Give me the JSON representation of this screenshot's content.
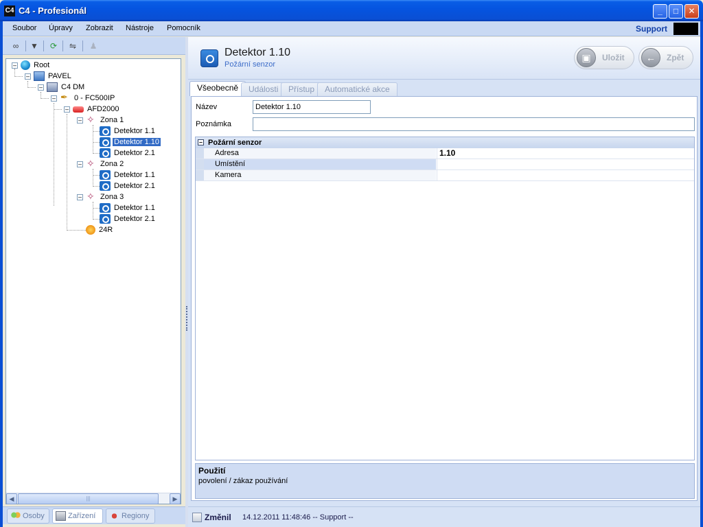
{
  "window": {
    "title": "C4 - Profesionál",
    "icon_text": "C4"
  },
  "menu": {
    "items": [
      "Soubor",
      "Úpravy",
      "Zobrazit",
      "Nástroje",
      "Pomocník"
    ],
    "support_label": "Support"
  },
  "tree": {
    "nodes": [
      {
        "label": "Root",
        "icon": "globe-icon"
      },
      {
        "label": "PAVEL",
        "icon": "computer-icon"
      },
      {
        "label": "C4 DM",
        "icon": "server-icon"
      },
      {
        "label": "0 - FC500IP",
        "icon": "controller-icon"
      },
      {
        "label": "AFD2000",
        "icon": "fire-panel-icon"
      },
      {
        "label": "Zona 1",
        "icon": "zone-icon"
      },
      {
        "label": "Detektor 1.1",
        "icon": "detector-icon"
      },
      {
        "label": "Detektor 1.10",
        "icon": "detector-icon",
        "selected": true
      },
      {
        "label": "Detektor 2.1",
        "icon": "detector-icon"
      },
      {
        "label": "Zona 2",
        "icon": "zone-icon"
      },
      {
        "label": "Detektor 1.1",
        "icon": "detector-icon"
      },
      {
        "label": "Detektor 2.1",
        "icon": "detector-icon"
      },
      {
        "label": "Zona 3",
        "icon": "zone-icon"
      },
      {
        "label": "Detektor 1.1",
        "icon": "detector-icon"
      },
      {
        "label": "Detektor 2.1",
        "icon": "detector-icon"
      },
      {
        "label": "24R",
        "icon": "relay-icon"
      }
    ]
  },
  "bottom_tabs": [
    "Osoby",
    "Zařízení",
    "Regiony"
  ],
  "header": {
    "title": "Detektor 1.10",
    "subtitle": "Požární senzor",
    "save_label": "Uložit",
    "back_label": "Zpět"
  },
  "tabs": [
    "Všeobecně",
    "Události",
    "Přístup",
    "Automatické akce"
  ],
  "form": {
    "name_label": "Název",
    "name_value": "Detektor 1.10",
    "note_label": "Poznámka",
    "note_value": ""
  },
  "properties": {
    "section_title": "Požární senzor",
    "rows": [
      {
        "name": "Adresa",
        "value": "1.10"
      },
      {
        "name": "Umístění",
        "value": ""
      },
      {
        "name": "Kamera",
        "value": ""
      }
    ]
  },
  "help": {
    "title": "Použití",
    "text": "povolení / zákaz používání"
  },
  "status": {
    "label": "Změnil",
    "value": "14.12.2011 11:48:46 -- Support --"
  }
}
